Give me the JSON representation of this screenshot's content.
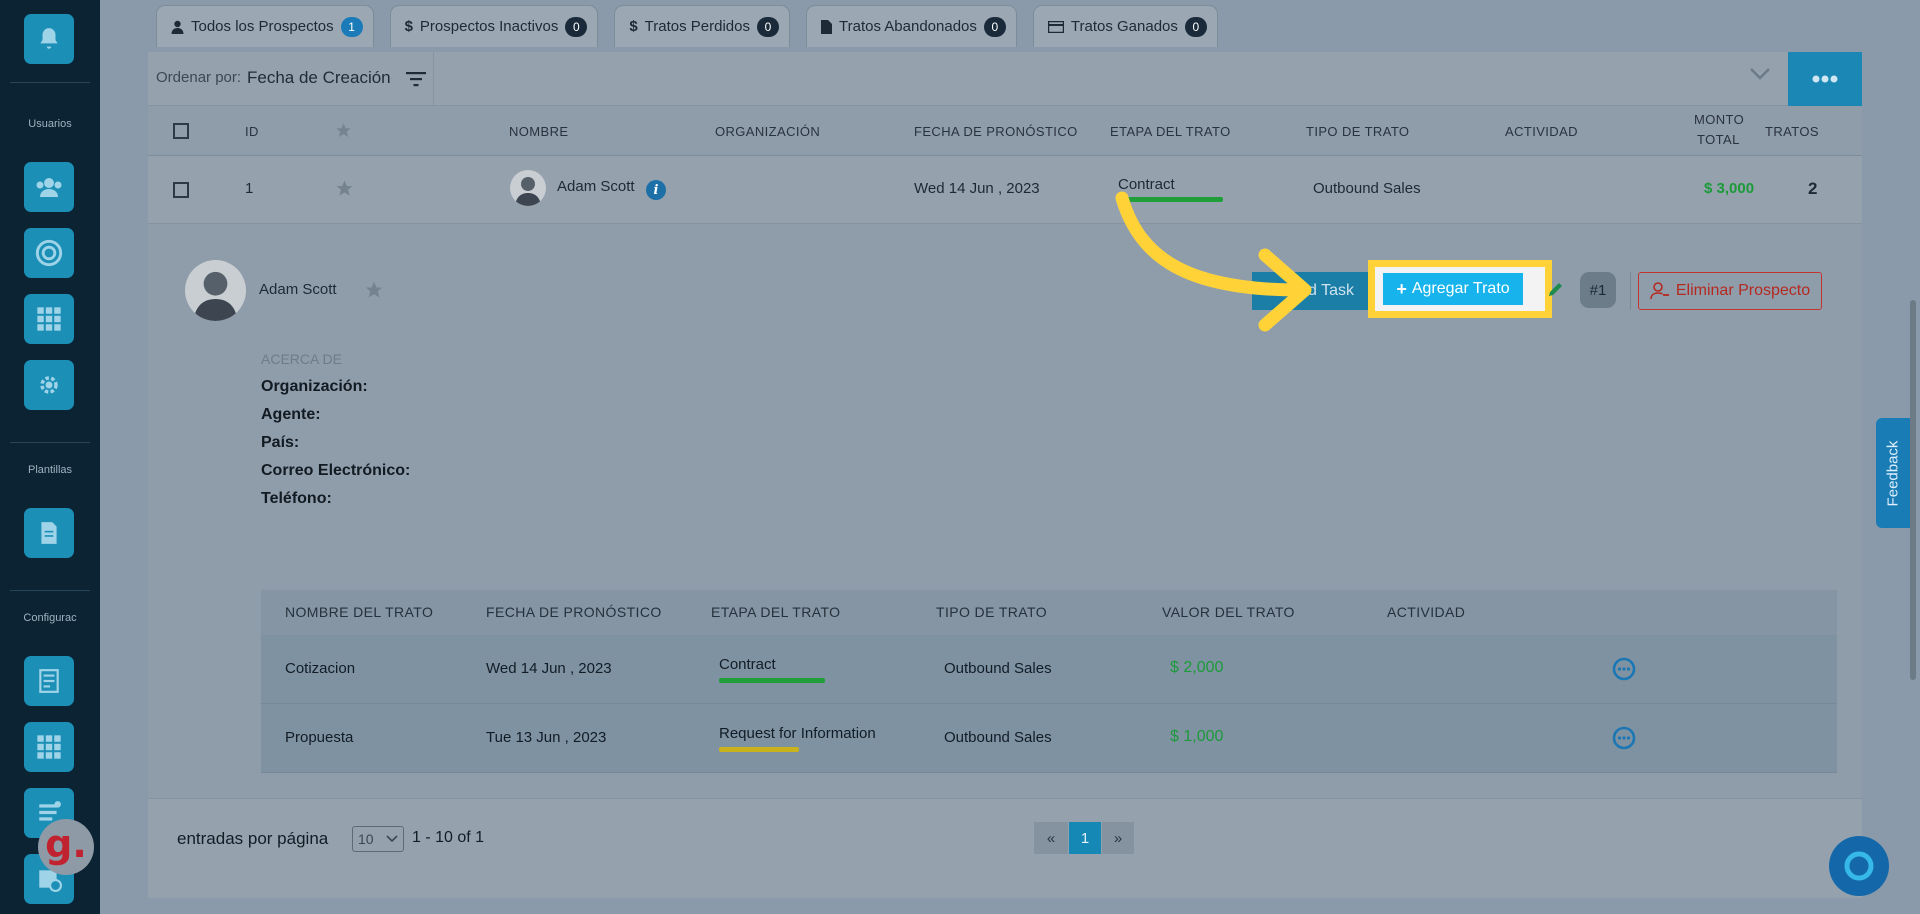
{
  "sidebar": {
    "sections": [
      "Usuarios",
      "Plantillas",
      "Configurac"
    ],
    "logo_letter": "g."
  },
  "tabs": [
    {
      "label": "Todos los Prospectos",
      "count": "1",
      "icon": "user-icon"
    },
    {
      "label": "Prospectos Inactivos",
      "count": "0",
      "icon": "dollar-icon"
    },
    {
      "label": "Tratos Perdidos",
      "count": "0",
      "icon": "dollar-icon"
    },
    {
      "label": "Tratos Abandonados",
      "count": "0",
      "icon": "file-icon"
    },
    {
      "label": "Tratos Ganados",
      "count": "0",
      "icon": "card-icon"
    }
  ],
  "sort": {
    "label": "Ordenar por:",
    "value": "Fecha de Creación"
  },
  "table": {
    "headers": [
      "ID",
      "NOMBRE",
      "ORGANIZACIÓN",
      "FECHA DE PRONÓSTICO",
      "ETAPA DEL TRATO",
      "TIPO DE TRATO",
      "ACTIVIDAD",
      "MONTO",
      "TOTAL",
      "TRATOS"
    ],
    "row": {
      "id": "1",
      "name": "Adam Scott",
      "date": "Wed 14 Jun , 2023",
      "stage": "Contract",
      "type": "Outbound Sales",
      "amount": "$ 3,000",
      "deals": "2"
    }
  },
  "detail": {
    "name": "Adam Scott",
    "task_button": "d Task",
    "add_deal_button": "Agregar Trato",
    "number_badge": "#1",
    "delete_button": "Eliminar Prospecto",
    "about_label": "ACERCA DE",
    "fields": [
      "Organización:",
      "Agente:",
      "País:",
      "Correo Electrónico:",
      "Teléfono:"
    ]
  },
  "deals": {
    "headers": [
      "NOMBRE DEL TRATO",
      "FECHA DE PRONÓSTICO",
      "ETAPA DEL TRATO",
      "TIPO DE TRATO",
      "VALOR DEL TRATO",
      "ACTIVIDAD"
    ],
    "rows": [
      {
        "name": "Cotizacion",
        "date": "Wed 14 Jun , 2023",
        "stage": "Contract",
        "type": "Outbound Sales",
        "value": "$ 2,000",
        "stage_color": "#1f9e3a"
      },
      {
        "name": "Propuesta",
        "date": "Tue 13 Jun , 2023",
        "stage": "Request for Information",
        "type": "Outbound Sales",
        "value": "$ 1,000",
        "stage_color": "#c9b21c"
      }
    ]
  },
  "pagination": {
    "entries_label": "entradas por página",
    "page_size": "10",
    "range": "1 - 10 of 1",
    "prev": "«",
    "current": "1",
    "next": "»"
  },
  "feedback_label": "Feedback",
  "colors": {
    "accent": "#16b3ec",
    "highlight": "#ffd338",
    "danger": "#c2342f",
    "money": "#1c9a3a"
  }
}
